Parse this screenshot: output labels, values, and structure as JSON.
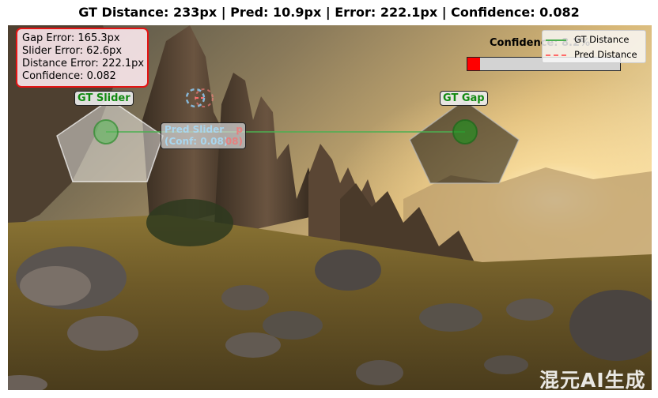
{
  "title": "GT Distance: 233px | Pred: 10.9px | Error: 222.1px | Confidence: 0.082",
  "info": {
    "gap_error": "Gap Error: 165.3px",
    "slider_error": "Slider Error: 62.6px",
    "distance_error": "Distance Error: 222.1px",
    "confidence": "Confidence: 0.082"
  },
  "labels": {
    "gt_slider": "GT Slider",
    "gt_gap": "GT Gap",
    "pred_slider_line1": "Pred Slider",
    "pred_slider_line2": "(Conf: 0.08)",
    "pred_gap_line1": "p",
    "pred_gap_line2": "08)"
  },
  "confidence_display": {
    "label": "Confidence: 8.2%",
    "value": 0.082,
    "fill_color": "#ff0000",
    "track_color": "#d3d3d3"
  },
  "legend": {
    "items": [
      {
        "label": "GT Distance",
        "style": "solid",
        "color": "#4caf50"
      },
      {
        "label": "Pred Distance",
        "style": "dashed",
        "color": "#ff6a6a"
      }
    ]
  },
  "watermark": "混元AI生成",
  "colors": {
    "gt_marker": "#22a022",
    "error_box_border": "#e41414",
    "pred_marker": "#87b8d8"
  },
  "icons": {
    "gt_slider_marker": "green-circle-icon",
    "gt_gap_marker": "green-circle-icon",
    "pred_slider_marker": "dashed-circle-icon"
  }
}
